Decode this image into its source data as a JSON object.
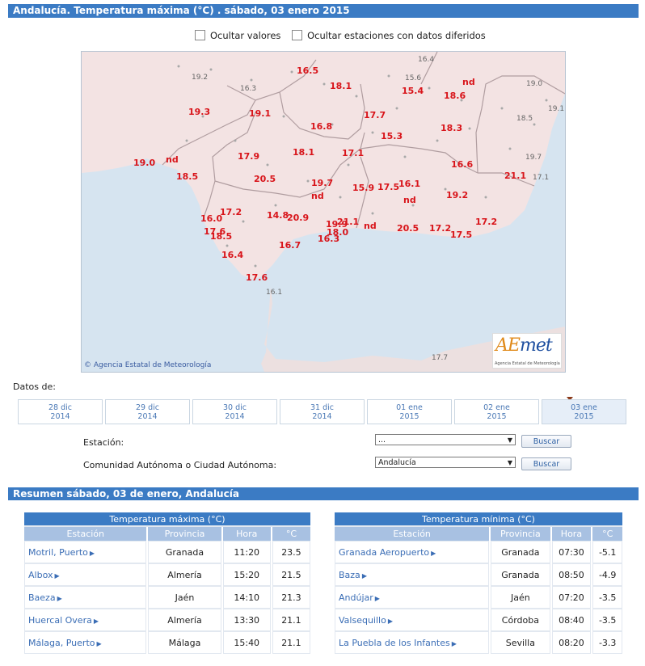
{
  "page_title": "Andalucía. Temperatura máxima (°C) . sábado, 03 enero 2015",
  "options": {
    "hide_values": "Ocultar valores",
    "hide_deferred": "Ocultar estaciones con datos diferidos"
  },
  "map": {
    "credit": "Agencia Estatal de Meteorología",
    "logo_main_a": "AE",
    "logo_main_b": "met",
    "logo_sub": "Agencia Estatal de Meteorología",
    "red_values": [
      "16.5",
      "18.1",
      "15.4",
      "nd",
      "18.6",
      "19.3",
      "19.1",
      "16.8",
      "17.7",
      "18.3",
      "15.3",
      "17.9",
      "18.1",
      "17.1",
      "16.6",
      "19.0",
      "nd",
      "18.5",
      "20.5",
      "19.7",
      "nd",
      "15.9",
      "17.5",
      "16.1",
      "nd",
      "19.2",
      "21.1",
      "17.2",
      "16.0",
      "14.8",
      "20.9",
      "19.9",
      "21.1",
      "18.0",
      "nd",
      "20.5",
      "17.2",
      "17.2",
      "17.6",
      "18.5",
      "16.7",
      "16.3",
      "17.5",
      "16.4",
      "17.6"
    ],
    "gray_values": [
      "16.4",
      "19.2",
      "16.3",
      "15.6",
      "19.0",
      "19.1",
      "18.5",
      "19.7",
      "17.1",
      "16.1",
      "17.7"
    ]
  },
  "datos_label": "Datos de:",
  "dates": [
    {
      "line1": "28 dic",
      "line2": "2014"
    },
    {
      "line1": "29 dic",
      "line2": "2014"
    },
    {
      "line1": "30 dic",
      "line2": "2014"
    },
    {
      "line1": "31 dic",
      "line2": "2014"
    },
    {
      "line1": "01 ene",
      "line2": "2015"
    },
    {
      "line1": "02 ene",
      "line2": "2015"
    },
    {
      "line1": "03 ene",
      "line2": "2015"
    }
  ],
  "station_label": "Estación:",
  "station_value": "...",
  "community_label": "Comunidad Autónoma o Ciudad Autónoma:",
  "community_value": "Andalucía",
  "search_button": "Buscar",
  "summary_title": "Resumen sábado, 03 de enero, Andalucía",
  "max_table": {
    "caption": "Temperatura máxima (°C)",
    "headers": [
      "Estación",
      "Provincia",
      "Hora",
      "°C"
    ],
    "rows": [
      [
        "Motril, Puerto",
        "Granada",
        "11:20",
        "23.5"
      ],
      [
        "Albox",
        "Almería",
        "15:20",
        "21.5"
      ],
      [
        "Baeza",
        "Jaén",
        "14:10",
        "21.3"
      ],
      [
        "Huercal Overa",
        "Almería",
        "13:30",
        "21.1"
      ],
      [
        "Málaga, Puerto",
        "Málaga",
        "15:40",
        "21.1"
      ]
    ]
  },
  "min_table": {
    "caption": "Temperatura mínima (°C)",
    "headers": [
      "Estación",
      "Provincia",
      "Hora",
      "°C"
    ],
    "rows": [
      [
        "Granada Aeropuerto",
        "Granada",
        "07:30",
        "-5.1"
      ],
      [
        "Baza",
        "Granada",
        "08:50",
        "-4.9"
      ],
      [
        "Andújar",
        "Jaén",
        "07:20",
        "-3.5"
      ],
      [
        "Valsequillo",
        "Córdoba",
        "08:40",
        "-3.5"
      ],
      [
        "La Puebla de los Infantes",
        "Sevilla",
        "08:20",
        "-3.3"
      ]
    ]
  },
  "colors": {
    "header_blue": "#3b7bc4",
    "value_red": "#d8141a",
    "land": "#f3e3e3",
    "sea": "#d6e4f0"
  }
}
